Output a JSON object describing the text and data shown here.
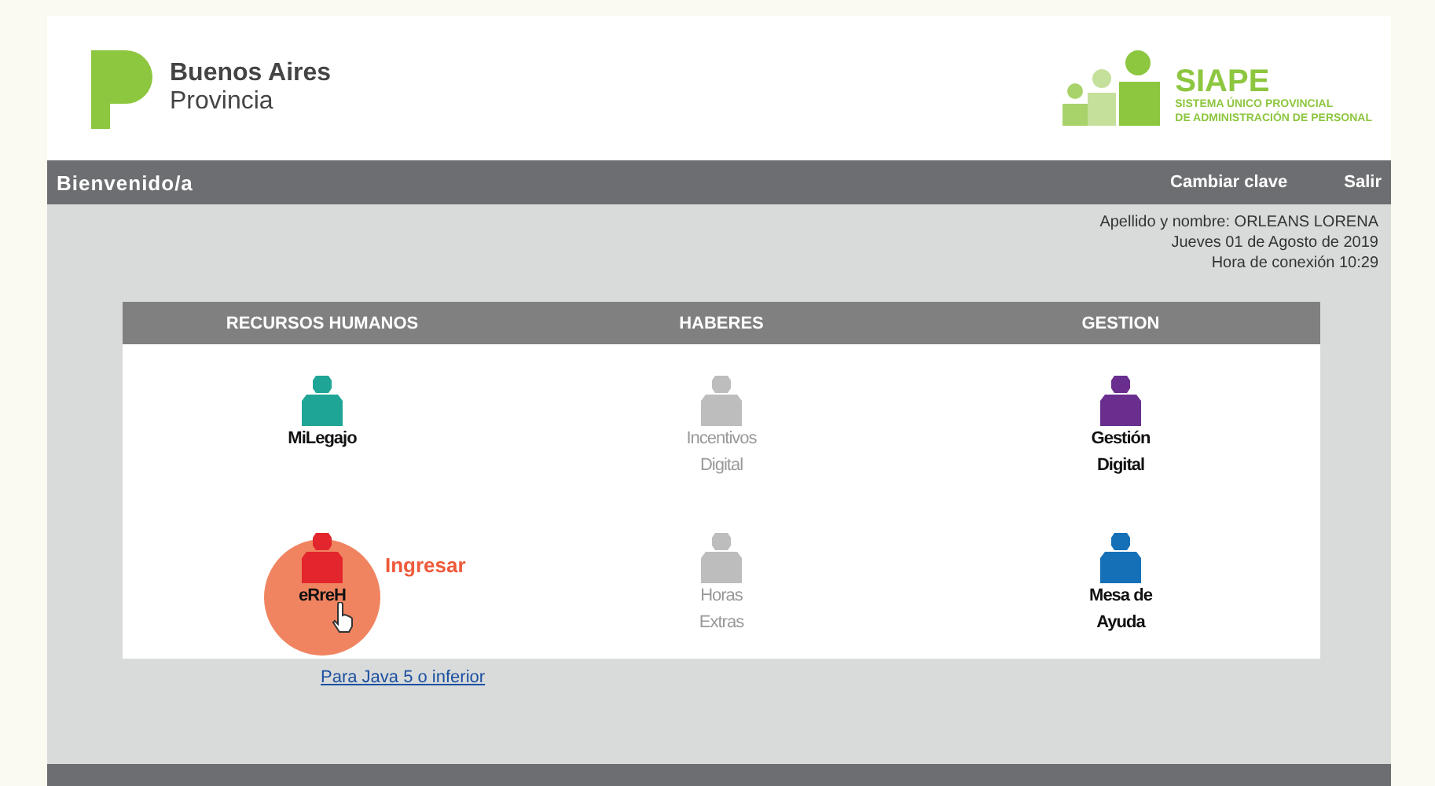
{
  "header": {
    "logo_line1": "Buenos Aires",
    "logo_line2": "Provincia",
    "brand": "SIAPE",
    "brand_sub1": "SISTEMA ÚNICO PROVINCIAL",
    "brand_sub2": "DE ADMINISTRACIÓN DE PERSONAL"
  },
  "navbar": {
    "greeting": "Bienvenido/a",
    "links": [
      "Cambiar clave",
      "Salir"
    ]
  },
  "user_info": [
    "Apellido y nombre: ORLEANS LORENA",
    "Jueves 01 de Agosto de 2019",
    "Hora de conexión 10:29"
  ],
  "columns": [
    {
      "title": "RECURSOS HUMANOS",
      "items": [
        {
          "label": "MiLegajo",
          "color": "#1fa596",
          "disabled": false,
          "highlighted": false
        },
        {
          "label": "eRreH",
          "color": "#e3262d",
          "disabled": false,
          "highlighted": true,
          "callout": "Ingresar"
        }
      ]
    },
    {
      "title": "HABERES",
      "items": [
        {
          "label": "Incentivos Digital",
          "color": "#bdbdbd",
          "disabled": true,
          "highlighted": false
        },
        {
          "label": "Horas Extras",
          "color": "#bdbdbd",
          "disabled": true,
          "highlighted": false
        }
      ]
    },
    {
      "title": "GESTION",
      "items": [
        {
          "label": "Gestión Digital",
          "color": "#6a2f8e",
          "disabled": false,
          "highlighted": false
        },
        {
          "label": "Mesa de Ayuda",
          "color": "#1570b8",
          "disabled": false,
          "highlighted": false
        }
      ]
    }
  ],
  "java_link": "Para Java 5 o inferior"
}
